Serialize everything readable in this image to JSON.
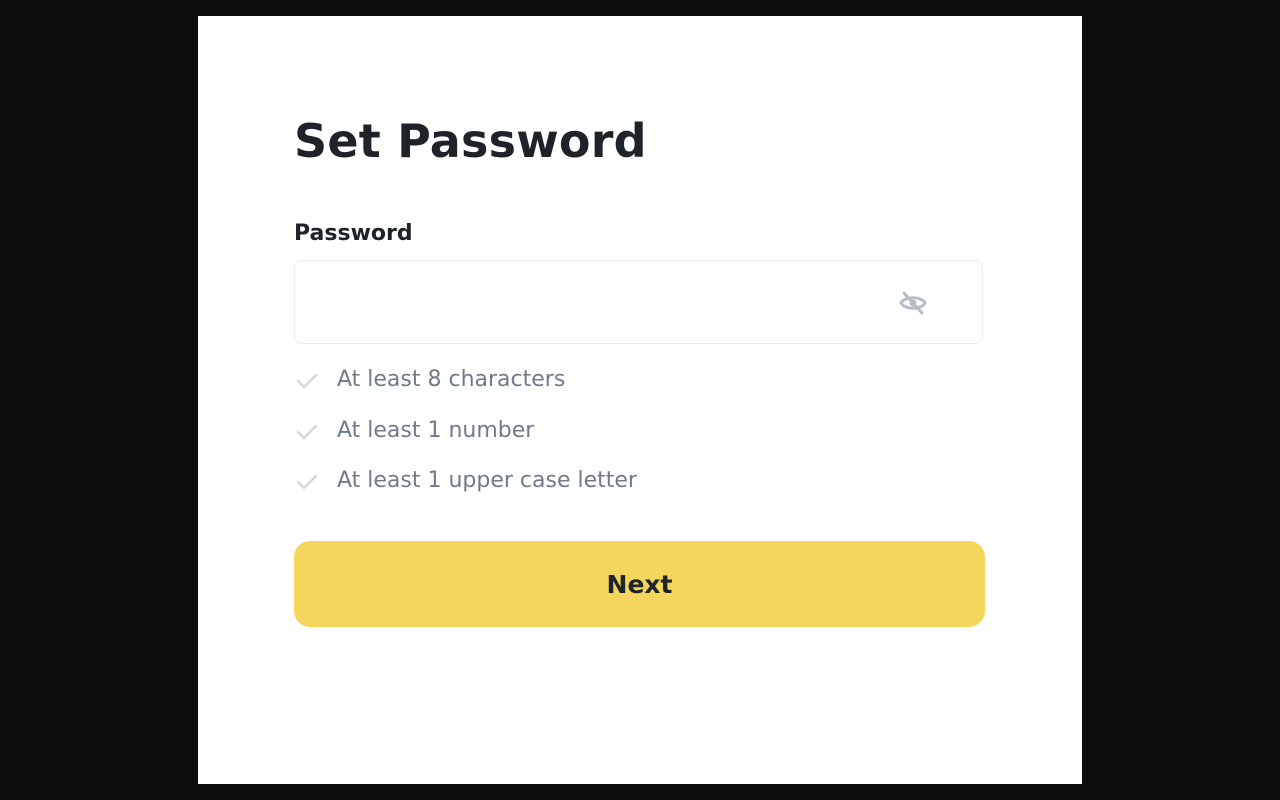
{
  "page": {
    "title": "Set Password"
  },
  "password_field": {
    "label": "Password",
    "value": "",
    "placeholder": ""
  },
  "icons": {
    "visibility_toggle": "eye-slash-icon",
    "rule_status": "check-icon"
  },
  "rules": [
    {
      "text": "At least 8 characters",
      "satisfied": false
    },
    {
      "text": "At least 1 number",
      "satisfied": false
    },
    {
      "text": "At least 1 upper case letter",
      "satisfied": false
    }
  ],
  "actions": {
    "next_label": "Next"
  },
  "colors": {
    "backdrop": "#0c0c0c",
    "card": "#ffffff",
    "primary_button": "#f5d65c",
    "text_primary": "#1e2329",
    "text_secondary": "#707a8a",
    "check_inactive": "#d5d8dc"
  }
}
